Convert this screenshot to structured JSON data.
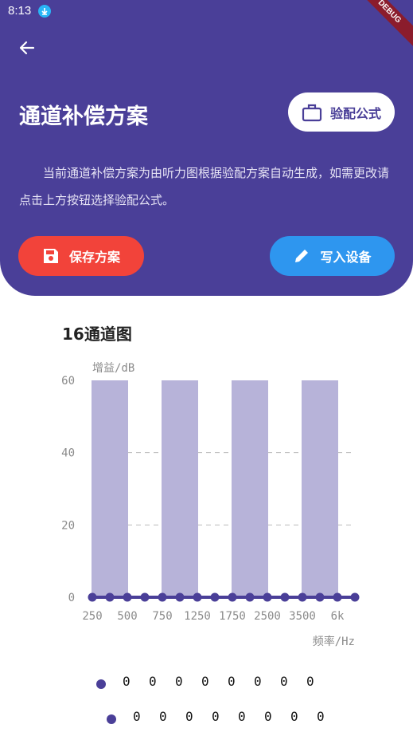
{
  "status_bar": {
    "time": "8:13",
    "debug_label": "DEBUG"
  },
  "header": {
    "title": "通道补偿方案",
    "formula_button": "验配公式",
    "description": "当前通道补偿方案为由听力图根据验配方案自动生成，如需更改请点击上方按钮选择验配公式。",
    "save_button": "保存方案",
    "write_button": "写入设备"
  },
  "chart_title": "16通道图",
  "chart_data": {
    "type": "bar",
    "title": "16通道图",
    "ylabel": "增益/dB",
    "xlabel": "频率/Hz",
    "ylim": [
      0,
      60
    ],
    "yticks": [
      0,
      20,
      40,
      60
    ],
    "x_tick_labels": [
      "250",
      "500",
      "750",
      "1250",
      "1750",
      "2500",
      "3500",
      "6k"
    ],
    "bands": [
      {
        "from": 250,
        "to": 500,
        "value": 60
      },
      {
        "from": 750,
        "to": 1250,
        "value": 60
      },
      {
        "from": 1750,
        "to": 2500,
        "value": 60
      },
      {
        "from": 3500,
        "to": "6k",
        "value": 60
      }
    ],
    "series": [
      {
        "values": [
          0,
          0,
          0,
          0,
          0,
          0,
          0,
          0,
          0,
          0,
          0,
          0,
          0,
          0,
          0,
          0
        ]
      }
    ],
    "grid": true,
    "colors": {
      "bar": "#b7b3d9",
      "line": "#4a3f98",
      "grid": "#bbbbbb"
    }
  },
  "legend_rows": [
    [
      "0",
      "0",
      "0",
      "0",
      "0",
      "0",
      "0",
      "0"
    ],
    [
      "0",
      "0",
      "0",
      "0",
      "0",
      "0",
      "0",
      "0"
    ]
  ],
  "colors": {
    "primary": "#4a3f98",
    "save": "#f2433a",
    "write": "#2e96ef"
  }
}
